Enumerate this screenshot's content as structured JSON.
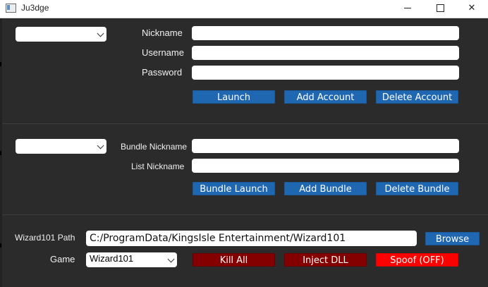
{
  "window": {
    "title": "Ju3dge",
    "icon": "app-window-icon"
  },
  "account": {
    "combo_value": "",
    "nickname_label": "Nickname",
    "username_label": "Username",
    "password_label": "Password",
    "nickname_value": "",
    "username_value": "",
    "password_value": "",
    "launch_label": "Launch",
    "add_label": "Add Account",
    "delete_label": "Delete Account"
  },
  "bundle": {
    "combo_value": "",
    "bundle_nickname_label": "Bundle Nickname",
    "list_nickname_label": "List Nickname",
    "bundle_nickname_value": "",
    "list_nickname_value": "",
    "launch_label": "Bundle Launch",
    "add_label": "Add Bundle",
    "delete_label": "Delete Bundle"
  },
  "settings": {
    "path_label": "Wizard101 Path",
    "path_value": "C:/ProgramData/KingsIsle Entertainment/Wizard101",
    "browse_label": "Browse",
    "game_label": "Game",
    "game_value": "Wizard101",
    "kill_label": "Kill All",
    "inject_label": "Inject DLL",
    "spoof_label": "Spoof (OFF)"
  },
  "colors": {
    "background": "#2b2b2b",
    "blue_button": "#1f67b1",
    "dark_red_button": "#840000",
    "red_button": "#ff0000"
  }
}
